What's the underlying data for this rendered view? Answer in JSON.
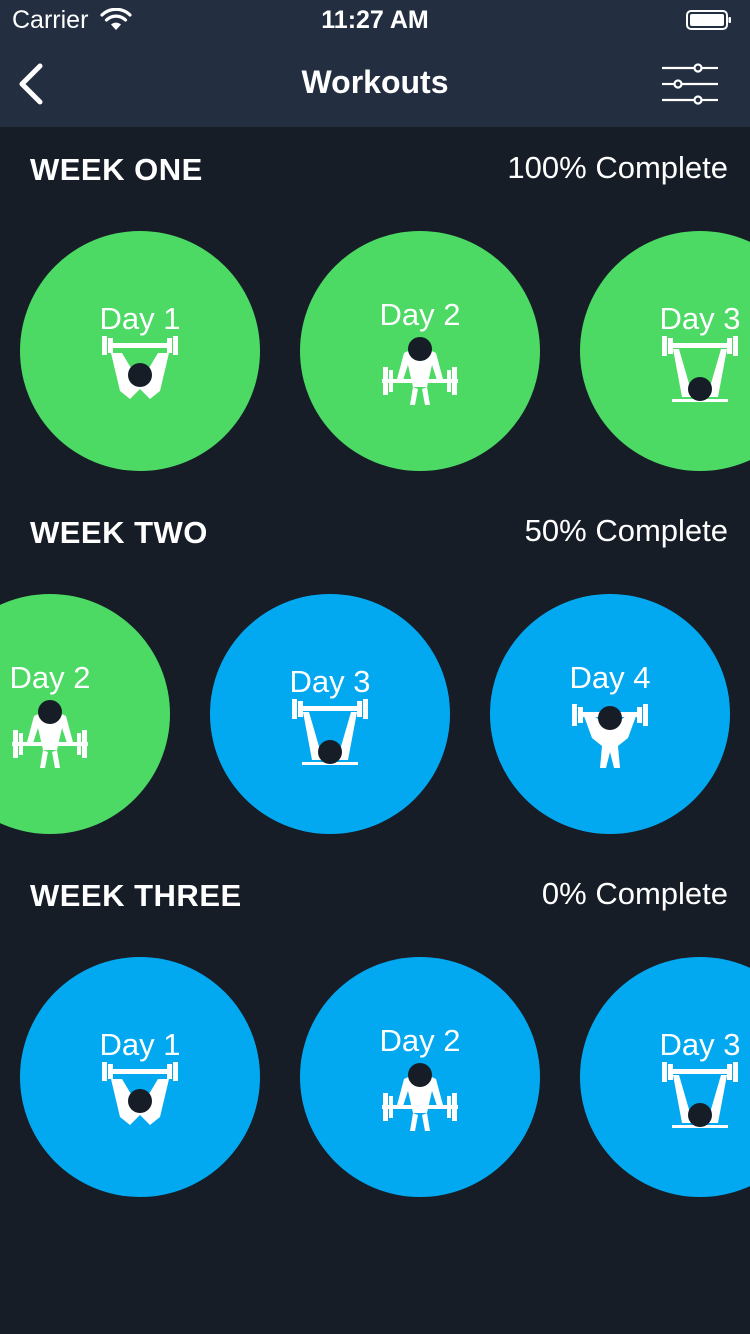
{
  "status": {
    "carrier": "Carrier",
    "time": "11:27 AM"
  },
  "nav": {
    "title": "Workouts"
  },
  "weeks": [
    {
      "title": "WEEK ONE",
      "progress": "100% Complete",
      "days": [
        {
          "label": "Day 1",
          "status": "complete",
          "icon": "overhead-press-icon"
        },
        {
          "label": "Day 2",
          "status": "complete",
          "icon": "deadlift-icon"
        },
        {
          "label": "Day 3",
          "status": "complete",
          "icon": "bench-press-icon"
        }
      ]
    },
    {
      "title": "WEEK TWO",
      "progress": "50% Complete",
      "days": [
        {
          "label": "Day 2",
          "status": "complete",
          "icon": "deadlift-icon"
        },
        {
          "label": "Day 3",
          "status": "incomplete",
          "icon": "bench-press-icon"
        },
        {
          "label": "Day 4",
          "status": "incomplete",
          "icon": "squat-icon"
        }
      ]
    },
    {
      "title": "WEEK THREE",
      "progress": "0% Complete",
      "days": [
        {
          "label": "Day 1",
          "status": "incomplete",
          "icon": "overhead-press-icon"
        },
        {
          "label": "Day 2",
          "status": "incomplete",
          "icon": "deadlift-icon"
        },
        {
          "label": "Day 3",
          "status": "incomplete",
          "icon": "bench-press-icon"
        }
      ]
    }
  ],
  "colors": {
    "background": "#161d27",
    "nav_bar": "#232f40",
    "complete": "#4cd964",
    "incomplete": "#03a9f0",
    "text": "#ffffff"
  }
}
